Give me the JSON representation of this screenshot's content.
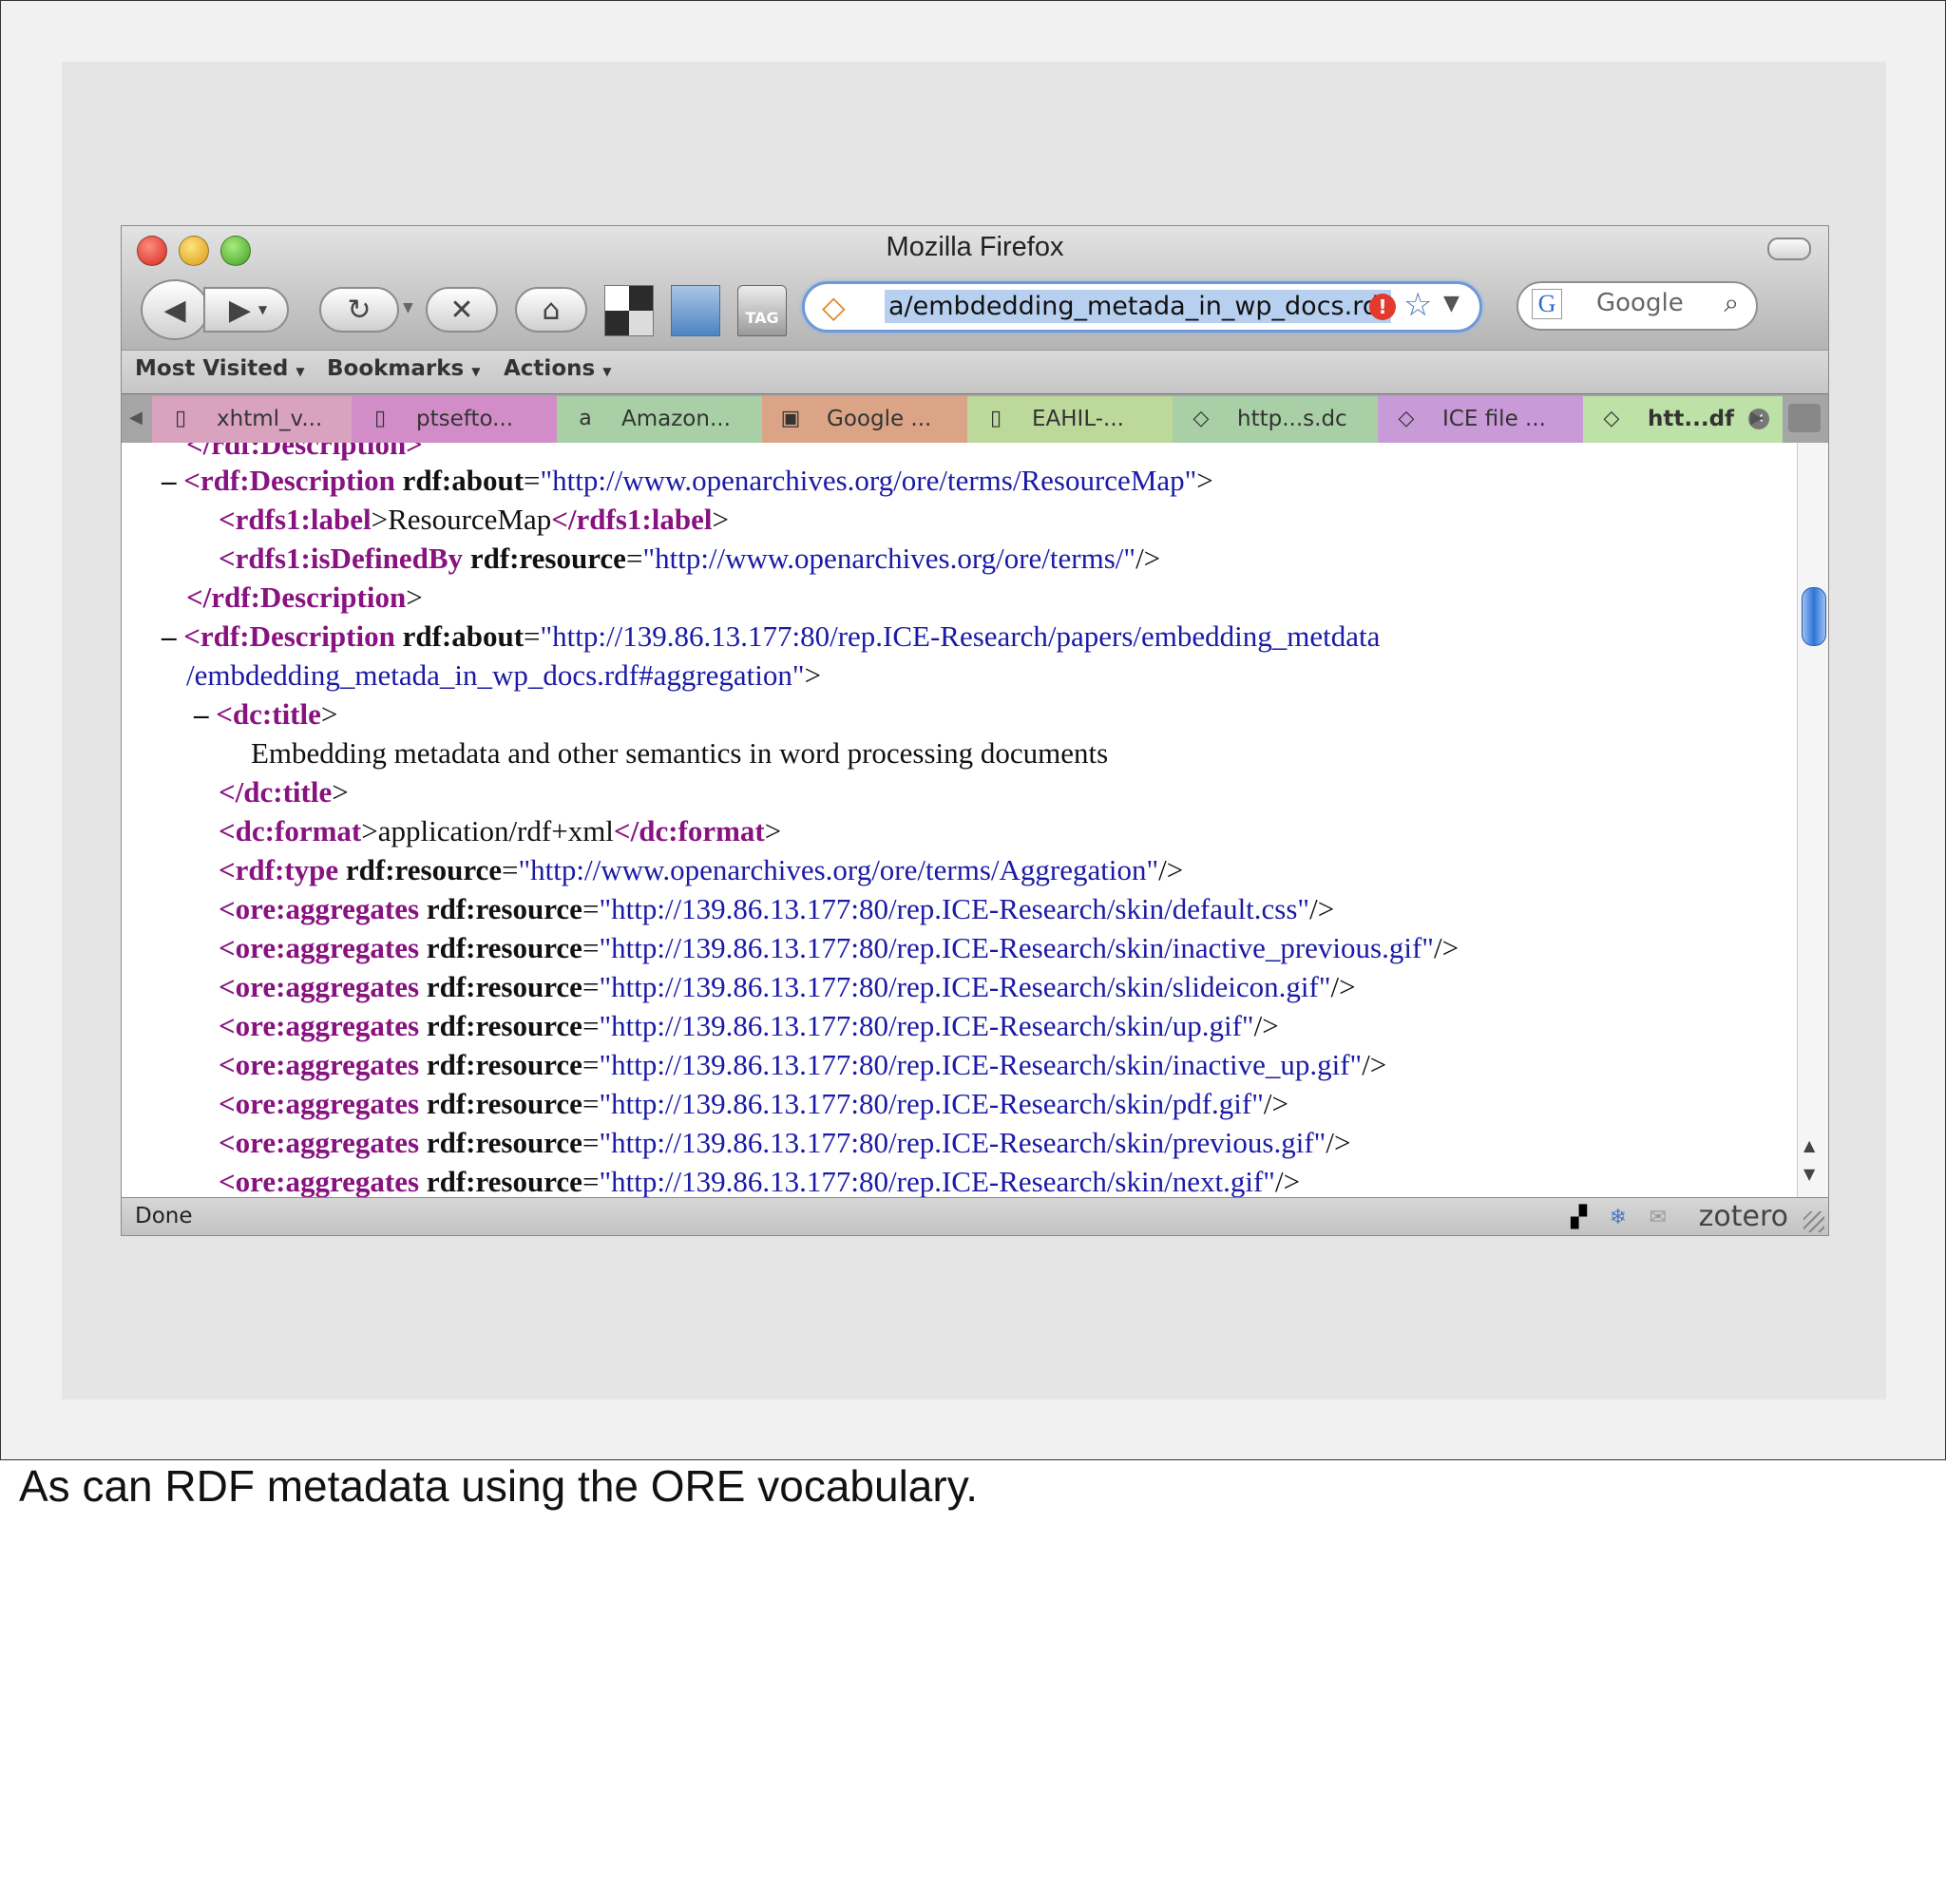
{
  "window": {
    "title": "Mozilla Firefox"
  },
  "toolbar": {
    "url": "a/embdedding_metada_in_wp_docs.rdf",
    "search_placeholder": "Google",
    "tag_icon_label": "TAG"
  },
  "bookmarks": [
    "Most Visited",
    "Bookmarks",
    "Actions"
  ],
  "tabs": [
    {
      "label": "xhtml_v...",
      "icon": "page-icon",
      "color": "#d9a3bf"
    },
    {
      "label": "ptsefto...",
      "icon": "page-icon",
      "color": "#d28dc8"
    },
    {
      "label": "Amazon...",
      "icon": "amazon-icon",
      "color": "#a8cfa6"
    },
    {
      "label": "Google ...",
      "icon": "feed-icon",
      "color": "#dba487"
    },
    {
      "label": "EAHIL-...",
      "icon": "page-icon",
      "color": "#bcd89a"
    },
    {
      "label": "http...s.dc",
      "icon": "xml-icon",
      "color": "#a8cfa6"
    },
    {
      "label": "ICE file ...",
      "icon": "xml-icon",
      "color": "#c89ad8"
    },
    {
      "label": "htt...df",
      "icon": "xml-icon",
      "color": "#bde1a7",
      "active": true
    }
  ],
  "xml_lines": {
    "l0": {
      "close": "</rdf:Description>"
    },
    "l1": {
      "minus": "–",
      "open": "<",
      "tag": "rdf:Description",
      "attr": "rdf:about",
      "eq": "=",
      "val": "\"http://www.openarchives.org/ore/terms/ResourceMap\"",
      "end": ">"
    },
    "l2": {
      "open": "<",
      "tag": "rdfs1:label",
      "mid": ">",
      "text": "ResourceMap",
      "open2": "</",
      "tag2": "rdfs1:label",
      "end": ">"
    },
    "l3": {
      "open": "<",
      "tag": "rdfs1:isDefinedBy",
      "attr": "rdf:resource",
      "eq": "=",
      "val": "\"http://www.openarchives.org/ore/terms/\"",
      "end": "/>"
    },
    "l4": {
      "open": "</",
      "tag": "rdf:Description",
      "end": ">"
    },
    "l5": {
      "minus": "–",
      "open": "<",
      "tag": "rdf:Description",
      "attr": "rdf:about",
      "eq": "=",
      "val": "\"http://139.86.13.177:80/rep.ICE-Research/papers/embedding_metdata"
    },
    "l6": {
      "val": "/embdedding_metada_in_wp_docs.rdf#aggregation\"",
      "end": ">"
    },
    "l7": {
      "minus": "–",
      "open": "<",
      "tag": "dc:title",
      "end": ">"
    },
    "l8": {
      "text": "Embedding metadata and other semantics in word processing documents"
    },
    "l9": {
      "open": "</",
      "tag": "dc:title",
      "end": ">"
    },
    "l10": {
      "open": "<",
      "tag": "dc:format",
      "mid": ">",
      "text": "application/rdf+xml",
      "open2": "</",
      "tag2": "dc:format",
      "end": ">"
    },
    "l11": {
      "open": "<",
      "tag": "rdf:type",
      "attr": "rdf:resource",
      "eq": "=",
      "val": "\"http://www.openarchives.org/ore/terms/Aggregation\"",
      "end": "/>"
    },
    "aggregates": {
      "tag": "ore:aggregates",
      "attr": "rdf:resource",
      "values": [
        "\"http://139.86.13.177:80/rep.ICE-Research/skin/default.css\"",
        "\"http://139.86.13.177:80/rep.ICE-Research/skin/inactive_previous.gif\"",
        "\"http://139.86.13.177:80/rep.ICE-Research/skin/slideicon.gif\"",
        "\"http://139.86.13.177:80/rep.ICE-Research/skin/up.gif\"",
        "\"http://139.86.13.177:80/rep.ICE-Research/skin/inactive_up.gif\"",
        "\"http://139.86.13.177:80/rep.ICE-Research/skin/pdf.gif\"",
        "\"http://139.86.13.177:80/rep.ICE-Research/skin/previous.gif\"",
        "\"http://139.86.13.177:80/rep.ICE-Research/skin/next.gif\""
      ]
    }
  },
  "status": {
    "text": "Done",
    "zotero": "zotero"
  },
  "caption": "As can RDF metadata using the ORE vocabulary."
}
